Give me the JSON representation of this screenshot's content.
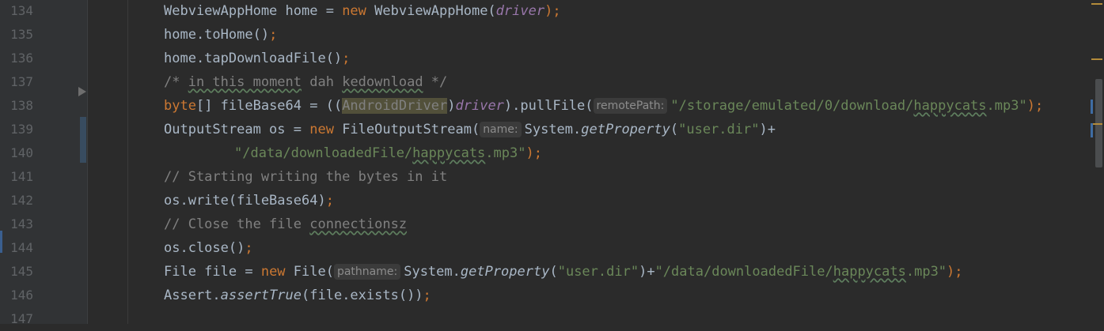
{
  "editor": {
    "lines": [
      {
        "num": "134"
      },
      {
        "num": "135"
      },
      {
        "num": "136"
      },
      {
        "num": "137"
      },
      {
        "num": "138"
      },
      {
        "num": "139"
      },
      {
        "num": "140"
      },
      {
        "num": "141"
      },
      {
        "num": "142"
      },
      {
        "num": "143"
      },
      {
        "num": "144"
      },
      {
        "num": "145"
      },
      {
        "num": "146"
      },
      {
        "num": "147"
      }
    ],
    "tokens": {
      "l134": {
        "type": "WebviewAppHome",
        "var": " home = ",
        "kw_new": "new",
        "ctor": " WebviewAppHome(",
        "arg": "driver",
        "end": ");"
      },
      "l135": {
        "text": "home.toHome()",
        "end": ";"
      },
      "l136": {
        "text": "home.tapDownloadFile()",
        "end": ";"
      },
      "l137": {
        "c1": "/* ",
        "c2": "in this moment",
        "c3": " dah ",
        "c4": "kedownload",
        "c5": " */"
      },
      "l138": {
        "kw_byte": "byte",
        "t1": "[] fileBase64 = ((",
        "cast": "AndroidDriver",
        "t2": ")",
        "arg": "driver",
        "t3": ").pullFile(",
        "hint": "remotePath:",
        "s1": "\"/storage/emulated/0/download/",
        "s2": "happycats",
        "s3": ".mp3\"",
        "end": ");"
      },
      "l139": {
        "t1": "OutputStream os = ",
        "kw_new": "new",
        "t2": " FileOutputStream(",
        "hint": "name:",
        "t3": "System.",
        "method": "getProperty",
        "t4": "(",
        "s1": "\"user.dir\"",
        "t5": ")+"
      },
      "l140": {
        "s1": "\"/data/downloadedFile/",
        "s2": "happycats",
        "s3": ".mp3\"",
        "end": ");"
      },
      "l141": {
        "comment": "// Starting writing the bytes in it"
      },
      "l142": {
        "text": "os.write(fileBase64)",
        "end": ";"
      },
      "l143": {
        "c1": "// Close the file ",
        "c2": "connectionsz"
      },
      "l144": {
        "text": "os.close()",
        "end": ";"
      },
      "l145": {
        "t1": "File file = ",
        "kw_new": "new",
        "t2": " File(",
        "hint": "pathname:",
        "t3": "System.",
        "method": "getProperty",
        "t4": "(",
        "s1": "\"user.dir\"",
        "t5": ")+",
        "s2": "\"/data/downloadedFile/",
        "s3": "happycats",
        "s4": ".mp3\"",
        "end": ");"
      },
      "l146": {
        "t1": "Assert.",
        "method": "assertTrue",
        "t2": "(file.exists())",
        "end": ";"
      }
    }
  },
  "colors": {
    "background": "#2b2b2b",
    "gutter": "#313335",
    "keyword": "#cc7832",
    "string": "#6a8759",
    "comment": "#808080",
    "field": "#9876aa",
    "text": "#a9b7c6",
    "line_number": "#606366"
  }
}
